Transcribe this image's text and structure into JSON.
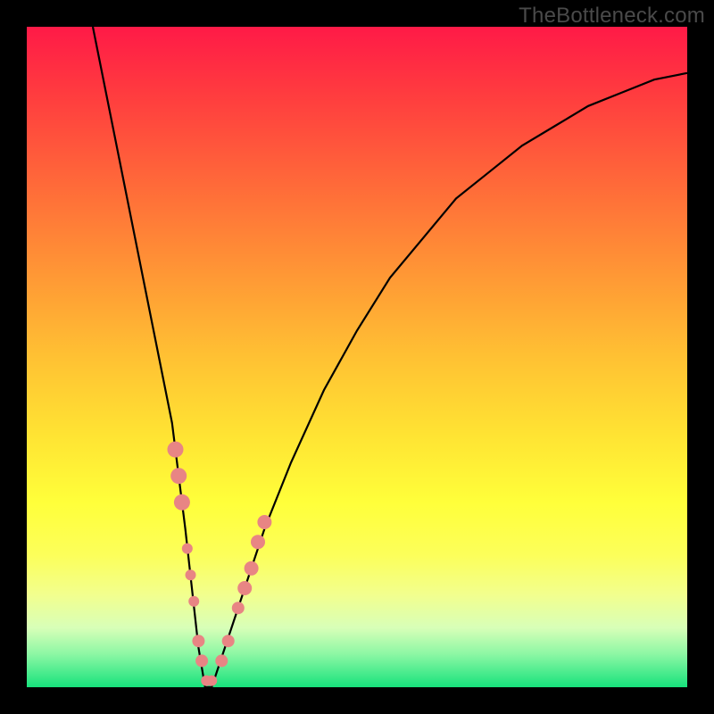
{
  "watermark": "TheBottleneck.com",
  "colors": {
    "curve_stroke": "#000000",
    "marker_fill": "#e88584",
    "frame_bg": "#000000"
  },
  "chart_data": {
    "type": "line",
    "title": "",
    "xlabel": "",
    "ylabel": "",
    "xlim": [
      0,
      100
    ],
    "ylim": [
      0,
      100
    ],
    "series": [
      {
        "name": "bottleneck-curve",
        "x": [
          10,
          12,
          14,
          16,
          18,
          20,
          22,
          24,
          25,
          26,
          27,
          28,
          30,
          33,
          36,
          40,
          45,
          50,
          55,
          60,
          65,
          70,
          75,
          80,
          85,
          90,
          95,
          100
        ],
        "y": [
          100,
          90,
          80,
          70,
          60,
          50,
          40,
          24,
          15,
          6,
          0,
          0,
          6,
          15,
          24,
          34,
          45,
          54,
          62,
          68,
          74,
          78,
          82,
          85,
          88,
          90,
          92,
          93
        ]
      }
    ],
    "markers": [
      {
        "x": 22.5,
        "y": 36,
        "r": 9
      },
      {
        "x": 23.0,
        "y": 32,
        "r": 9
      },
      {
        "x": 23.5,
        "y": 28,
        "r": 9
      },
      {
        "x": 24.3,
        "y": 21,
        "r": 6
      },
      {
        "x": 24.8,
        "y": 17,
        "r": 6
      },
      {
        "x": 25.3,
        "y": 13,
        "r": 6
      },
      {
        "x": 26.0,
        "y": 7,
        "r": 7
      },
      {
        "x": 26.5,
        "y": 4,
        "r": 7
      },
      {
        "x": 27.2,
        "y": 1,
        "r": 6
      },
      {
        "x": 28.0,
        "y": 1,
        "r": 6
      },
      {
        "x": 29.5,
        "y": 4,
        "r": 7
      },
      {
        "x": 30.5,
        "y": 7,
        "r": 7
      },
      {
        "x": 32.0,
        "y": 12,
        "r": 7
      },
      {
        "x": 33.0,
        "y": 15,
        "r": 8
      },
      {
        "x": 34.0,
        "y": 18,
        "r": 8
      },
      {
        "x": 35.0,
        "y": 22,
        "r": 8
      },
      {
        "x": 36.0,
        "y": 25,
        "r": 8
      }
    ]
  }
}
